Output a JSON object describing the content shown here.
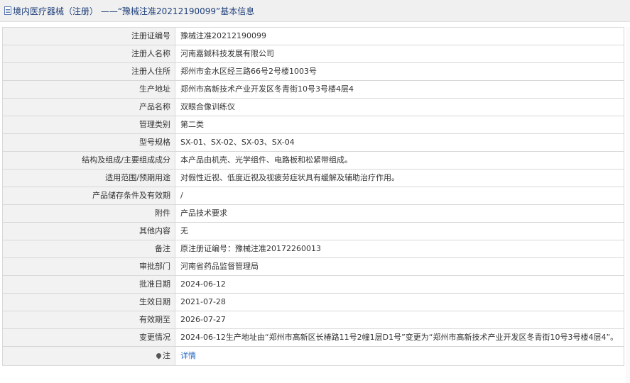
{
  "page": {
    "title": "境内医疗器械（注册） ——“豫械注准20212190099”基本信息"
  },
  "rows": [
    {
      "label": "注册证编号",
      "value": "豫械注准20212190099"
    },
    {
      "label": "注册人名称",
      "value": "河南嘉鋮科技发展有限公司"
    },
    {
      "label": "注册人住所",
      "value": "郑州市金水区经三路66号2号楼1003号"
    },
    {
      "label": "生产地址",
      "value": "郑州市高新技术产业开发区冬青街10号3号楼4层4"
    },
    {
      "label": "产品名称",
      "value": "双眼合像训练仪"
    },
    {
      "label": "管理类别",
      "value": "第二类"
    },
    {
      "label": "型号规格",
      "value": "SX-01、SX-02、SX-03、SX-04"
    },
    {
      "label": "结构及组成/主要组成成分",
      "value": "本产品由机壳、光学组件、电路板和松紧带组成。"
    },
    {
      "label": "适用范围/预期用途",
      "value": "对假性近视、低度近视及视疲劳症状具有缓解及辅助治疗作用。"
    },
    {
      "label": "产品储存条件及有效期",
      "value": "/"
    },
    {
      "label": "附件",
      "value": "产品技术要求"
    },
    {
      "label": "其他内容",
      "value": "无"
    },
    {
      "label": "备注",
      "value": "原注册证编号：豫械注准20172260013"
    },
    {
      "label": "审批部门",
      "value": "河南省药品监督管理局"
    },
    {
      "label": "批准日期",
      "value": "2024-06-12"
    },
    {
      "label": "生效日期",
      "value": "2021-07-28"
    },
    {
      "label": "有效期至",
      "value": "2026-07-27"
    },
    {
      "label": "变更情况",
      "value": "2024-06-12生产地址由“郑州市高新区长椿路11号2幢1层D1号”变更为“郑州市高新技术产业开发区冬青街10号3号楼4层4”。"
    }
  ],
  "note_row": {
    "label": "注",
    "link_text": "详情"
  },
  "icons": {
    "title_icon": "document-icon",
    "note_icon": "pin-icon"
  },
  "colors": {
    "title_text": "#1f3f7a",
    "link": "#2a6ac4",
    "label_bg": "#f2f2f2",
    "border": "#d8d8d8"
  }
}
